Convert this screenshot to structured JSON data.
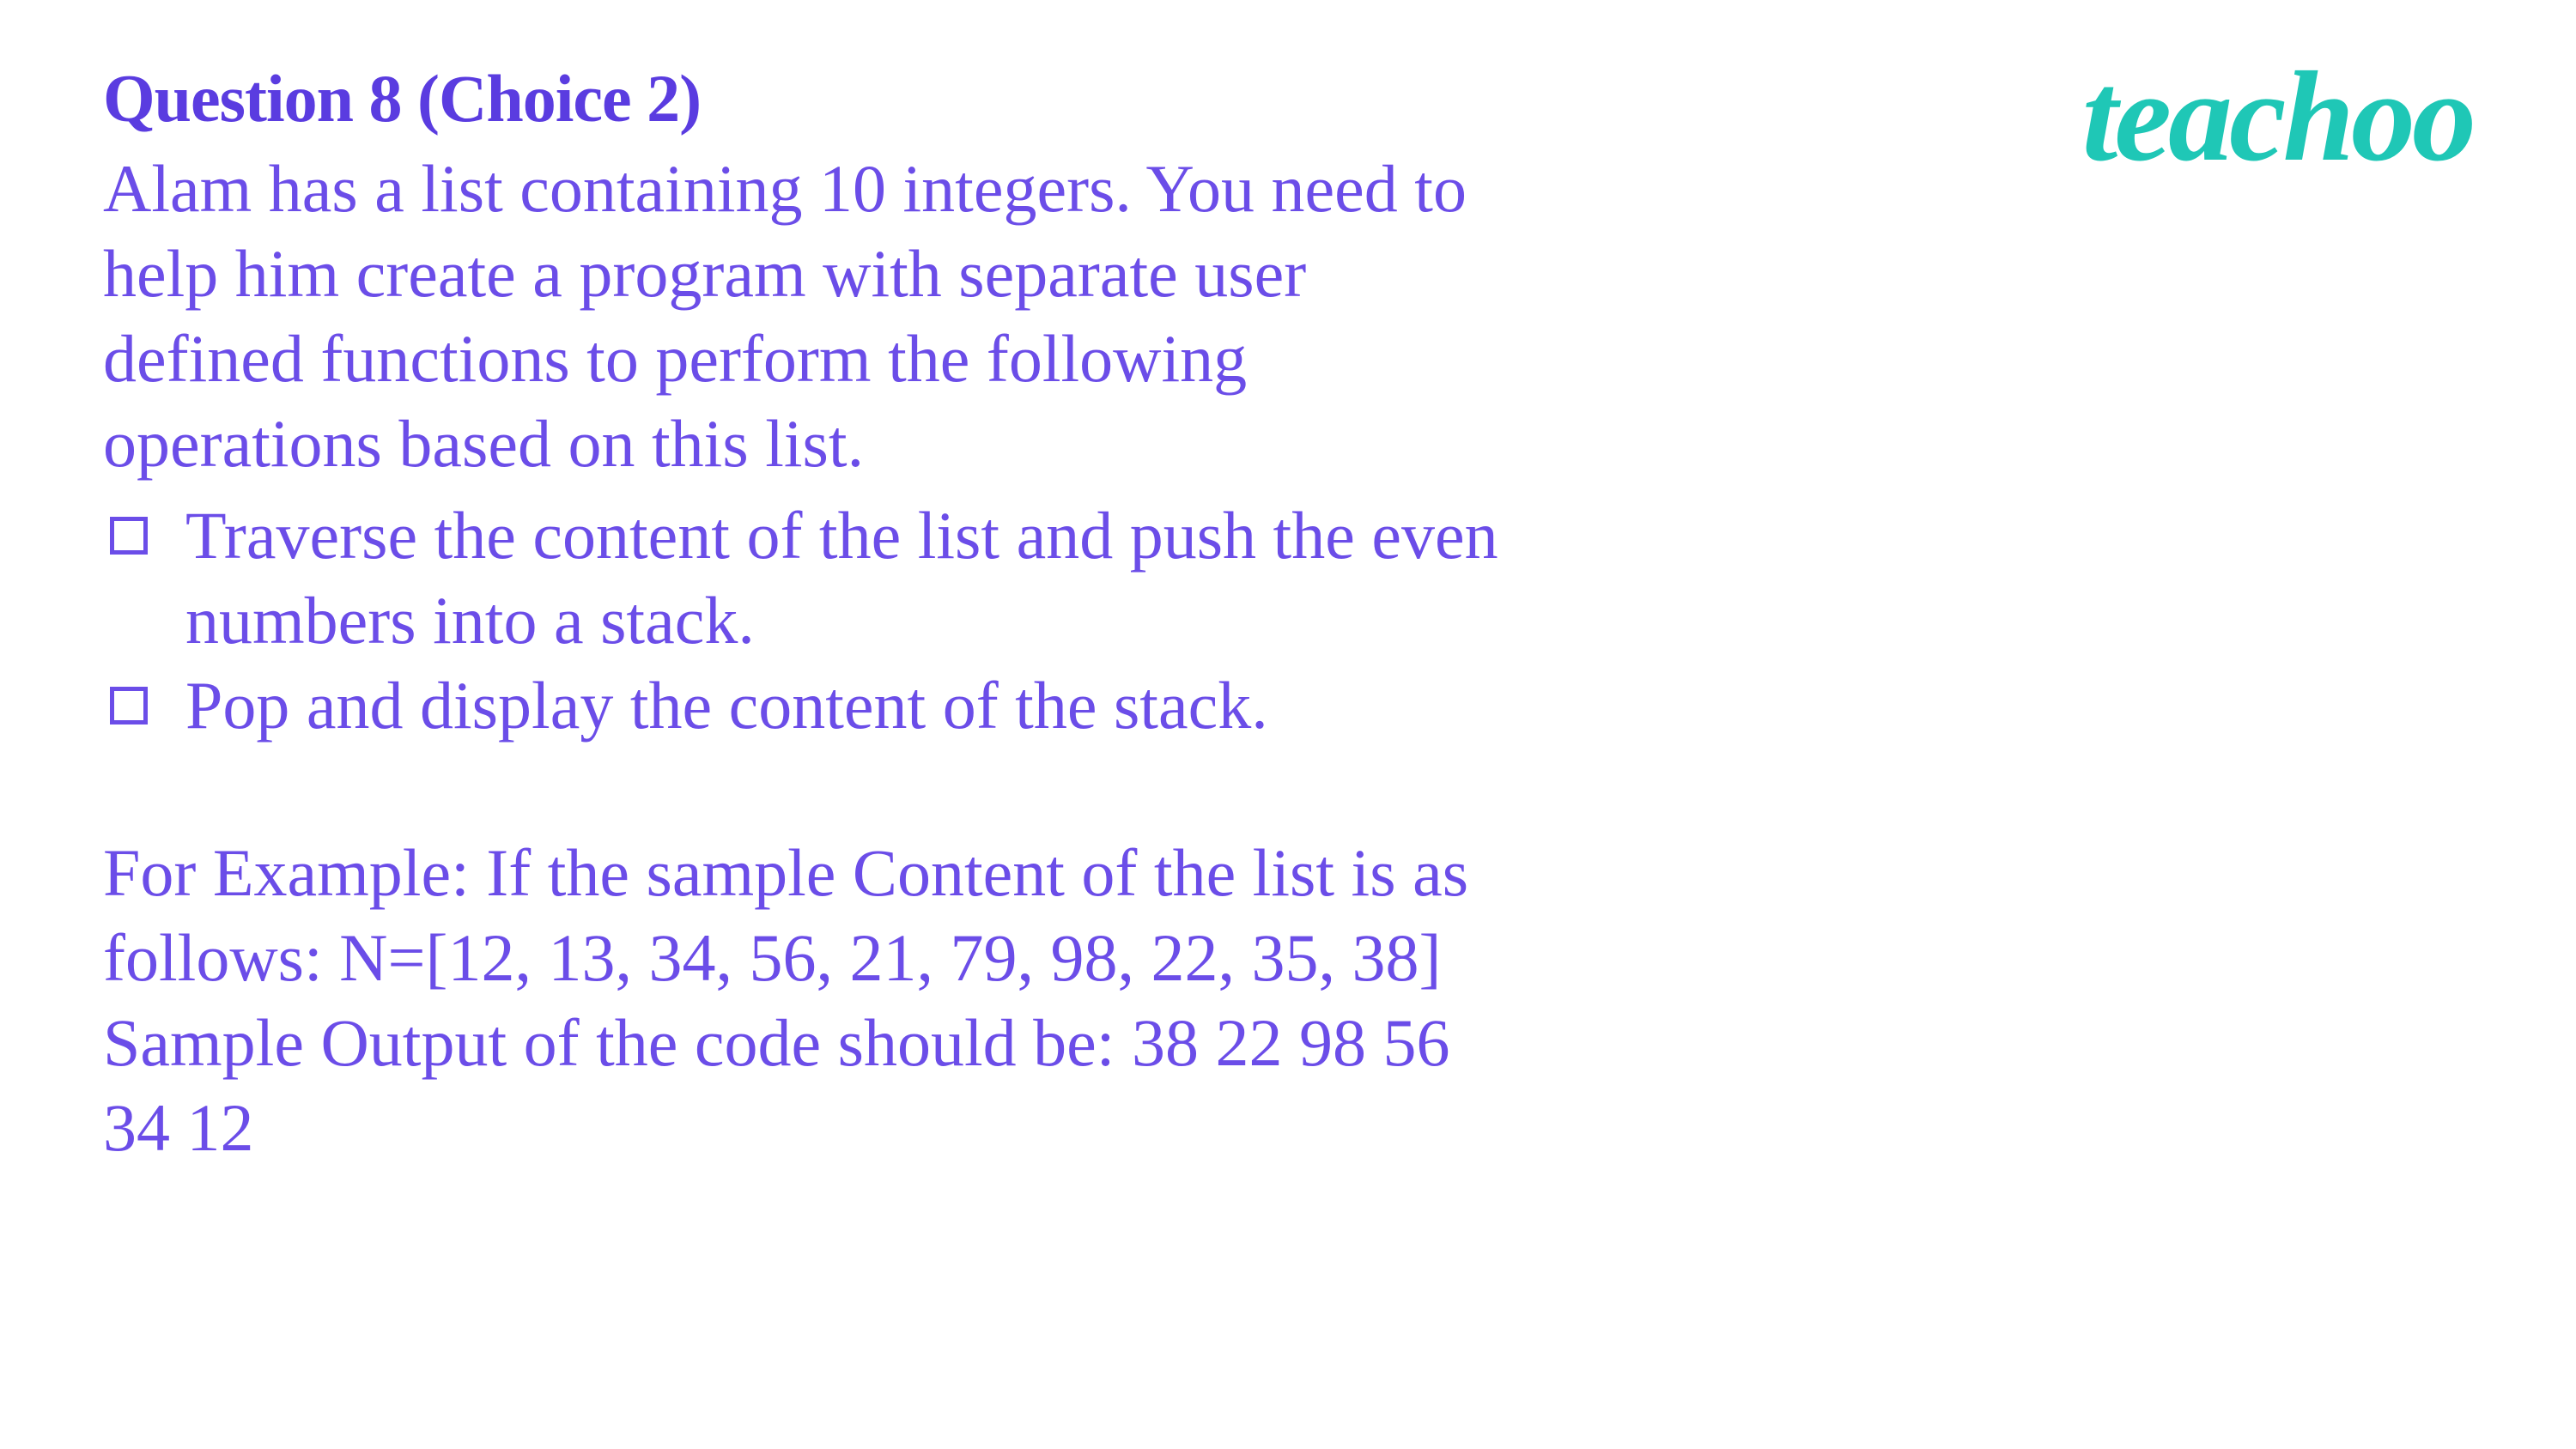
{
  "title": "Question 8 (Choice 2)",
  "intro": "Alam has a list containing 10 integers. You need to help him create a program with separate user defined functions to perform the following operations based on this list.",
  "bullets": [
    "Traverse the content of the list and push the even numbers into a stack.",
    "Pop and display the content of the stack."
  ],
  "example": " For Example: If the sample Content of the list is as follows: N=[12, 13, 34, 56, 21, 79, 98, 22, 35, 38]\nSample Output of the code should be: 38 22 98 56 34 12",
  "logo": "teachoo"
}
